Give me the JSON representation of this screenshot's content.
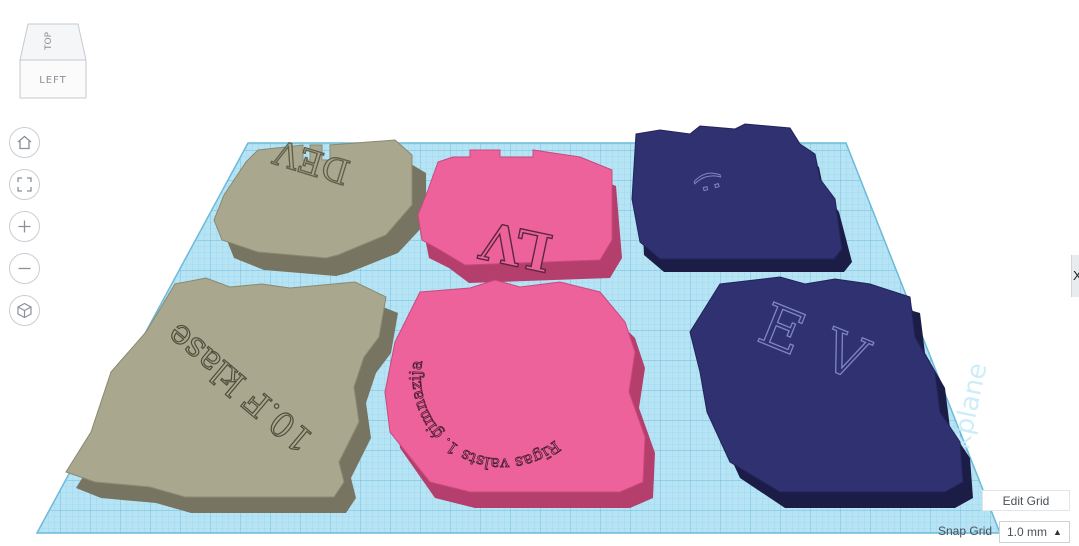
{
  "view_cube": {
    "top_label": "TOP",
    "left_label": "LEFT"
  },
  "nav_tools": {
    "home": "home-icon",
    "fit": "fit-view-icon",
    "zoom_in": "zoom-in-icon",
    "zoom_out": "zoom-out-icon",
    "perspective": "perspective-cube-icon"
  },
  "right_edge_tab": {
    "label": "X"
  },
  "workplane": {
    "watermark": "Workplane"
  },
  "plates": [
    {
      "id": "tan-dev",
      "color": "#a9a88f",
      "text": "DEV"
    },
    {
      "id": "pink-lv",
      "color": "#ee629b",
      "text": "LV"
    },
    {
      "id": "navy-smile",
      "color": "#2f3170",
      "text": ":)"
    },
    {
      "id": "tan-klase",
      "color": "#a9a88f",
      "text": "10.F klase"
    },
    {
      "id": "pink-gimnazija",
      "color": "#ee629b",
      "text": "Rīgas valsts 1. ģimnazija"
    },
    {
      "id": "navy-ev",
      "color": "#2f3170",
      "text": "EV"
    }
  ],
  "grid_controls": {
    "edit_grid_label": "Edit Grid",
    "snap_grid_label": "Snap Grid",
    "snap_grid_value": "1.0 mm"
  },
  "colors": {
    "grid": "#a9dff0",
    "grid_line": "#7ec6e2",
    "accent": "#2f3170"
  }
}
